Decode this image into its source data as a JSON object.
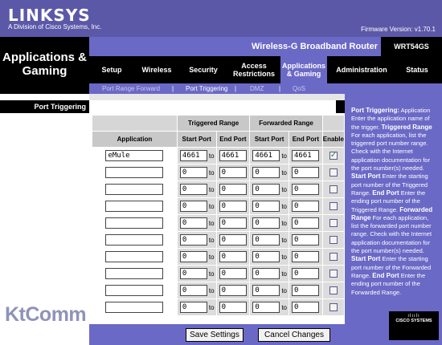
{
  "brand": {
    "logo": "LINKSYS",
    "sub": "A Division of Cisco Systems, Inc.",
    "firmware": "Firmware Version: v1.70.1"
  },
  "section_title": "Applications & Gaming",
  "product": {
    "name": "Wireless-G Broadband Router",
    "model": "WRT54GS"
  },
  "tabs": [
    {
      "label": "Setup"
    },
    {
      "label": "Wireless"
    },
    {
      "label": "Security"
    },
    {
      "label": "Access Restrictions"
    },
    {
      "label": "Applications & Gaming"
    },
    {
      "label": "Administration"
    },
    {
      "label": "Status"
    }
  ],
  "subtabs": [
    {
      "label": "Port Range Forward"
    },
    {
      "label": "Port Triggering"
    },
    {
      "label": "DMZ"
    },
    {
      "label": "QoS"
    }
  ],
  "subtab_sep": "|",
  "nav_label": "Port Triggering",
  "watermark": "KtComm",
  "table": {
    "group_headers": {
      "triggered": "Triggered Range",
      "forwarded": "Forwarded Range"
    },
    "col_headers": {
      "application": "Application",
      "start": "Start Port",
      "end": "End Port",
      "enable": "Enable"
    },
    "to_label": "to",
    "rows": [
      {
        "app": "eMule",
        "ts": "4661",
        "te": "4661",
        "fs": "4661",
        "fe": "4661",
        "enabled": true
      },
      {
        "app": "",
        "ts": "0",
        "te": "0",
        "fs": "0",
        "fe": "0",
        "enabled": false
      },
      {
        "app": "",
        "ts": "0",
        "te": "0",
        "fs": "0",
        "fe": "0",
        "enabled": false
      },
      {
        "app": "",
        "ts": "0",
        "te": "0",
        "fs": "0",
        "fe": "0",
        "enabled": false
      },
      {
        "app": "",
        "ts": "0",
        "te": "0",
        "fs": "0",
        "fe": "0",
        "enabled": false
      },
      {
        "app": "",
        "ts": "0",
        "te": "0",
        "fs": "0",
        "fe": "0",
        "enabled": false
      },
      {
        "app": "",
        "ts": "0",
        "te": "0",
        "fs": "0",
        "fe": "0",
        "enabled": false
      },
      {
        "app": "",
        "ts": "0",
        "te": "0",
        "fs": "0",
        "fe": "0",
        "enabled": false
      },
      {
        "app": "",
        "ts": "0",
        "te": "0",
        "fs": "0",
        "fe": "0",
        "enabled": false
      },
      {
        "app": "",
        "ts": "0",
        "te": "0",
        "fs": "0",
        "fe": "0",
        "enabled": false
      }
    ]
  },
  "help": {
    "title": "Port Triggering:",
    "p1": "Application Enter the application name of the trigger.",
    "k1": "Triggered Range",
    "p2": "For each application, list the triggered port number range. Check with the Internet application documentation for the port number(s) needed.",
    "k2": "Start Port",
    "p3": "Enter the starting port number of the Triggered Range.",
    "k3": "End Port",
    "p4": "Enter the ending port number of the Triggered Range.",
    "k4": "Forwarded Range",
    "p5": "For each application, list the forwarded port number range. Check with the Internet application documentation for the port number(s) needed.",
    "k5": "Start Port",
    "p6": "Enter the starting port number of the Forwarded Range.",
    "k6": "End Port",
    "p7": "Enter the ending port number of the Forwarded Range."
  },
  "buttons": {
    "save": "Save Settings",
    "cancel": "Cancel Changes"
  },
  "cisco": {
    "text": "CISCO SYSTEMS",
    "bars": "ılıılı"
  }
}
